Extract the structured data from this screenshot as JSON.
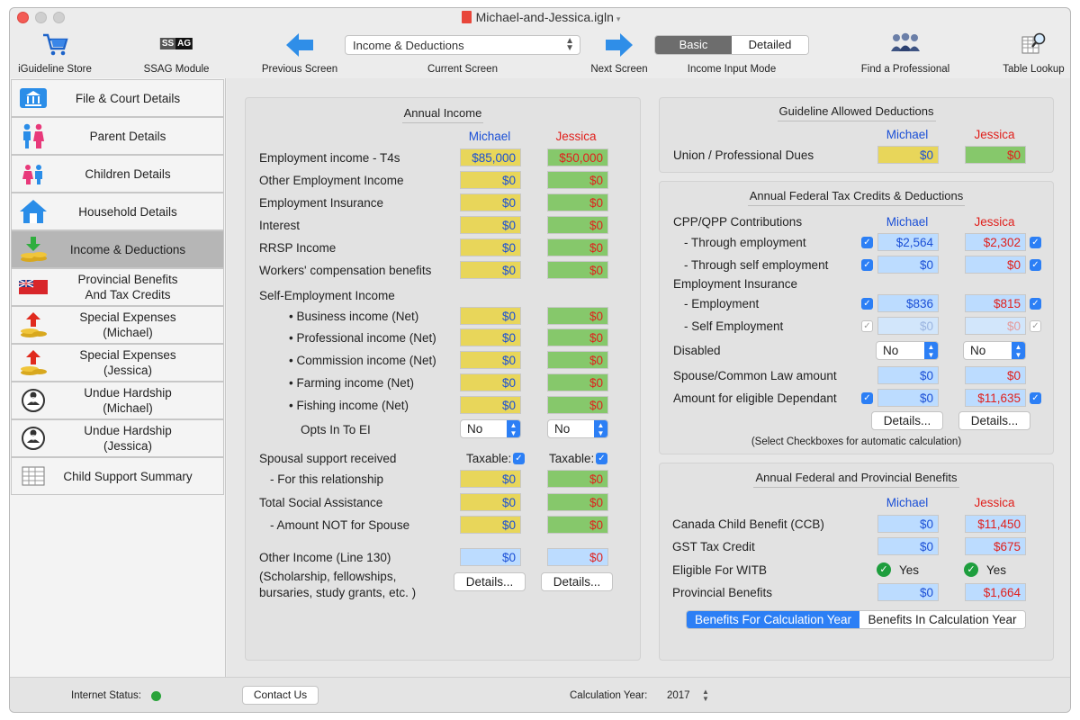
{
  "window": {
    "title": "Michael-and-Jessica.igln"
  },
  "toolbar": {
    "store": "iGuideline Store",
    "ssag": "SSAG Module",
    "ssag_badge_left": "SS",
    "ssag_badge_right": "AG",
    "prev": "Previous Screen",
    "current": "Current Screen",
    "current_value": "Income & Deductions",
    "next": "Next Screen",
    "mode_label": "Income Input Mode",
    "mode_basic": "Basic",
    "mode_detailed": "Detailed",
    "professional": "Find a Professional",
    "table": "Table Lookup"
  },
  "sidebar": {
    "items": [
      {
        "label": "File & Court Details",
        "icon": "courthouse-icon"
      },
      {
        "label": "Parent Details",
        "icon": "parents-icon"
      },
      {
        "label": "Children Details",
        "icon": "children-icon"
      },
      {
        "label": "Household Details",
        "icon": "house-icon"
      },
      {
        "label": "Income & Deductions",
        "icon": "income-icon"
      },
      {
        "label": "Provincial Benefits And Tax Credits",
        "icon": "flag-icon"
      },
      {
        "label": "Special Expenses (Michael)",
        "icon": "expenses-icon"
      },
      {
        "label": "Special Expenses (Jessica)",
        "icon": "expenses-icon"
      },
      {
        "label": "Undue Hardship (Michael)",
        "icon": "hardship-icon"
      },
      {
        "label": "Undue Hardship (Jessica)",
        "icon": "hardship-icon"
      },
      {
        "label": "Child Support Summary",
        "icon": "summary-icon"
      }
    ]
  },
  "parties": {
    "a": "Michael",
    "b": "Jessica"
  },
  "income": {
    "title": "Annual Income",
    "rows": [
      {
        "label": "Employment income - T4s",
        "m": "$85,000",
        "j": "$50,000"
      },
      {
        "label": "Other Employment Income",
        "m": "$0",
        "j": "$0"
      },
      {
        "label": "Employment Insurance",
        "m": "$0",
        "j": "$0"
      },
      {
        "label": "Interest",
        "m": "$0",
        "j": "$0"
      },
      {
        "label": "RRSP Income",
        "m": "$0",
        "j": "$0"
      },
      {
        "label": "Workers' compensation benefits",
        "m": "$0",
        "j": "$0"
      }
    ],
    "self_title": "Self-Employment Income",
    "self_rows": [
      {
        "label": "• Business income (Net)",
        "m": "$0",
        "j": "$0"
      },
      {
        "label": "• Professional income (Net)",
        "m": "$0",
        "j": "$0"
      },
      {
        "label": "• Commission income (Net)",
        "m": "$0",
        "j": "$0"
      },
      {
        "label": "• Farming income (Net)",
        "m": "$0",
        "j": "$0"
      },
      {
        "label": "• Fishing income (Net)",
        "m": "$0",
        "j": "$0"
      }
    ],
    "opts_label": "Opts In To EI",
    "opts_m": "No",
    "opts_j": "No",
    "spousal_label": "Spousal support received",
    "taxable": "Taxable:",
    "relationship_label": "- For this relationship",
    "relationship_m": "$0",
    "relationship_j": "$0",
    "social_label": "Total Social Assistance",
    "social_m": "$0",
    "social_j": "$0",
    "notspouse_label": "- Amount NOT for Spouse",
    "notspouse_m": "$0",
    "notspouse_j": "$0",
    "other_label": "Other Income (Line 130)",
    "other_m": "$0",
    "other_j": "$0",
    "other_note_1": "(Scholarship, fellowships,",
    "other_note_2": "bursaries, study grants, etc. )",
    "details": "Details..."
  },
  "deductions": {
    "title": "Guideline Allowed Deductions",
    "union_label": "Union / Professional Dues",
    "union_m": "$0",
    "union_j": "$0"
  },
  "credits": {
    "title": "Annual Federal Tax Credits & Deductions",
    "cpp_label": "CPP/QPP Contributions",
    "cpp_emp_label": "- Through employment",
    "cpp_emp_m": "$2,564",
    "cpp_emp_j": "$2,302",
    "cpp_self_label": "- Through self employment",
    "cpp_self_m": "$0",
    "cpp_self_j": "$0",
    "ei_label": "Employment Insurance",
    "ei_emp_label": "- Employment",
    "ei_emp_m": "$836",
    "ei_emp_j": "$815",
    "ei_self_label": "- Self Employment",
    "ei_self_m": "$0",
    "ei_self_j": "$0",
    "disabled_label": "Disabled",
    "disabled_m": "No",
    "disabled_j": "No",
    "spouse_label": "Spouse/Common Law amount",
    "spouse_m": "$0",
    "spouse_j": "$0",
    "dependant_label": "Amount for eligible Dependant",
    "dependant_m": "$0",
    "dependant_j": "$11,635",
    "details": "Details...",
    "note": "(Select Checkboxes for automatic calculation)"
  },
  "benefits": {
    "title": "Annual Federal and Provincial Benefits",
    "ccb_label": "Canada Child Benefit (CCB)",
    "ccb_m": "$0",
    "ccb_j": "$11,450",
    "gst_label": "GST Tax Credit",
    "gst_m": "$0",
    "gst_j": "$675",
    "witb_label": "Eligible For WITB",
    "witb_m": "Yes",
    "witb_j": "Yes",
    "prov_label": "Provincial Benefits",
    "prov_m": "$0",
    "prov_j": "$1,664",
    "seg_for": "Benefits For Calculation Year",
    "seg_in": "Benefits In Calculation Year"
  },
  "status": {
    "internet": "Internet Status:",
    "contact": "Contact Us",
    "calc_year_label": "Calculation Year:",
    "calc_year": "2017",
    "internet_color": "#2aa33a"
  }
}
